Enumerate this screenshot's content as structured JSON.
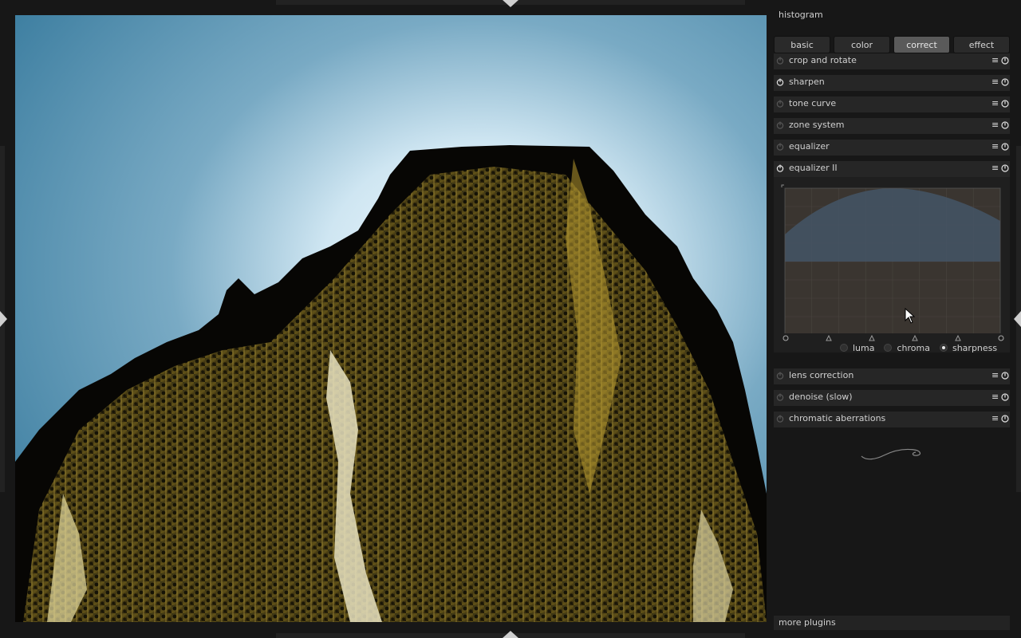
{
  "panel": {
    "header": "histogram",
    "tabs": [
      {
        "label": "basic"
      },
      {
        "label": "color"
      },
      {
        "label": "correct",
        "active": true
      },
      {
        "label": "effect"
      }
    ],
    "modules": [
      {
        "label": "crop and rotate",
        "enabled": false
      },
      {
        "label": "sharpen",
        "enabled": true
      },
      {
        "label": "tone curve",
        "enabled": false
      },
      {
        "label": "zone system",
        "enabled": false
      },
      {
        "label": "equalizer",
        "enabled": false
      },
      {
        "label": "equalizer II",
        "enabled": true,
        "expanded": true
      },
      {
        "label": "lens correction",
        "enabled": false
      },
      {
        "label": "denoise (slow)",
        "enabled": false
      },
      {
        "label": "chromatic aberrations",
        "enabled": false
      }
    ],
    "equalizer": {
      "modes": [
        {
          "label": "luma",
          "selected": false
        },
        {
          "label": "chroma",
          "selected": false
        },
        {
          "label": "sharpness",
          "selected": true
        }
      ]
    },
    "more_plugins": "more plugins"
  },
  "icons": {
    "module_menu": "menu-icon",
    "module_reset": "reset-icon",
    "module_power": "power-icon",
    "decor": "swirl-icon"
  },
  "colors": {
    "background": "#171717",
    "panel_module": "#262626",
    "active_tab": "#5a5a5a",
    "eq_curve_fill": "#445566"
  }
}
